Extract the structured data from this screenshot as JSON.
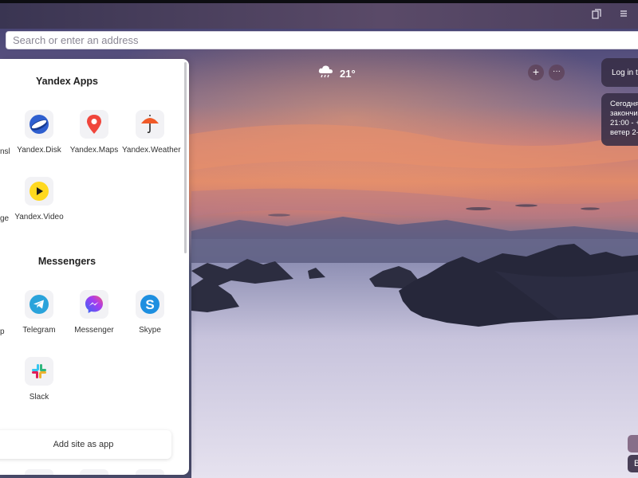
{
  "browser": {
    "address_placeholder": "Search or enter an address",
    "toolbar_icons": [
      "bookmarks-icon",
      "menu-icon"
    ]
  },
  "weather": {
    "temperature": "21°",
    "icon": "cloud-rain-icon"
  },
  "newtab_buttons": {
    "add": "+",
    "more": "···"
  },
  "right_widgets": {
    "login_text": "Log in t",
    "forecast_lines": [
      "Сегодня",
      "закончи",
      "21:00 - +",
      "ветер 2-"
    ],
    "corner_labels": [
      "",
      "В"
    ]
  },
  "sidebar": {
    "sections": [
      {
        "title": "Yandex Apps",
        "cut_labels": [
          "nsl",
          "ge"
        ],
        "apps": [
          {
            "name": "Yandex.Disk",
            "icon": "yandex-disk-icon"
          },
          {
            "name": "Yandex.Maps",
            "icon": "yandex-maps-icon"
          },
          {
            "name": "Yandex.Weather",
            "icon": "yandex-weather-icon"
          },
          {
            "name": "Yandex.Video",
            "icon": "yandex-video-icon"
          }
        ]
      },
      {
        "title": "Messengers",
        "cut_labels": [
          "p"
        ],
        "apps": [
          {
            "name": "Telegram",
            "icon": "telegram-icon"
          },
          {
            "name": "Messenger",
            "icon": "messenger-icon"
          },
          {
            "name": "Skype",
            "icon": "skype-icon"
          },
          {
            "name": "Slack",
            "icon": "slack-icon"
          }
        ]
      }
    ],
    "add_site_label": "Add site as app"
  },
  "colors": {
    "accent_sunset": "#e8845a",
    "panel_bg": "#ffffff",
    "telegram": "#2aa3db",
    "skype": "#1e8fe0",
    "maps_red": "#f0463c"
  }
}
